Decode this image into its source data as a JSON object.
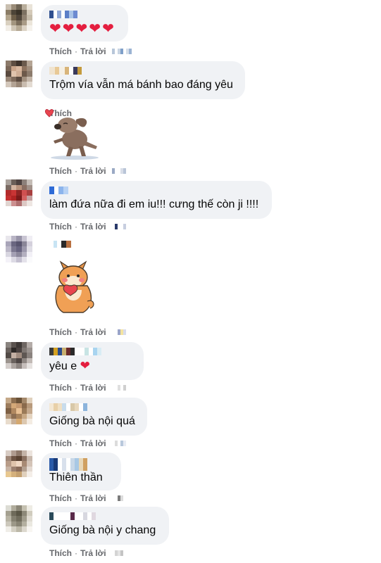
{
  "action_like": "Thích",
  "action_reply": "Trả lời",
  "separator": "·",
  "comments": [
    {
      "text": "",
      "hearts": 5
    },
    {
      "text": "Trộm vía vẫn má bánh bao đáng yêu"
    },
    {
      "sticker": "dog-sticker"
    },
    {
      "text": "làm đứa nữa đi em iu!!! cưng thế còn ji !!!!"
    },
    {
      "sticker": "shiba-heart-sticker"
    },
    {
      "text": "yêu e",
      "emoji": "❤"
    },
    {
      "text": "Giống bà nội quá"
    },
    {
      "text": "Thiên thần"
    },
    {
      "text": "Giống bà nội y chang"
    }
  ],
  "heart_glyph": "❤",
  "colors": {
    "bubble": "#f0f2f5",
    "action_text": "#65676b",
    "heart": "#e41e3f"
  }
}
